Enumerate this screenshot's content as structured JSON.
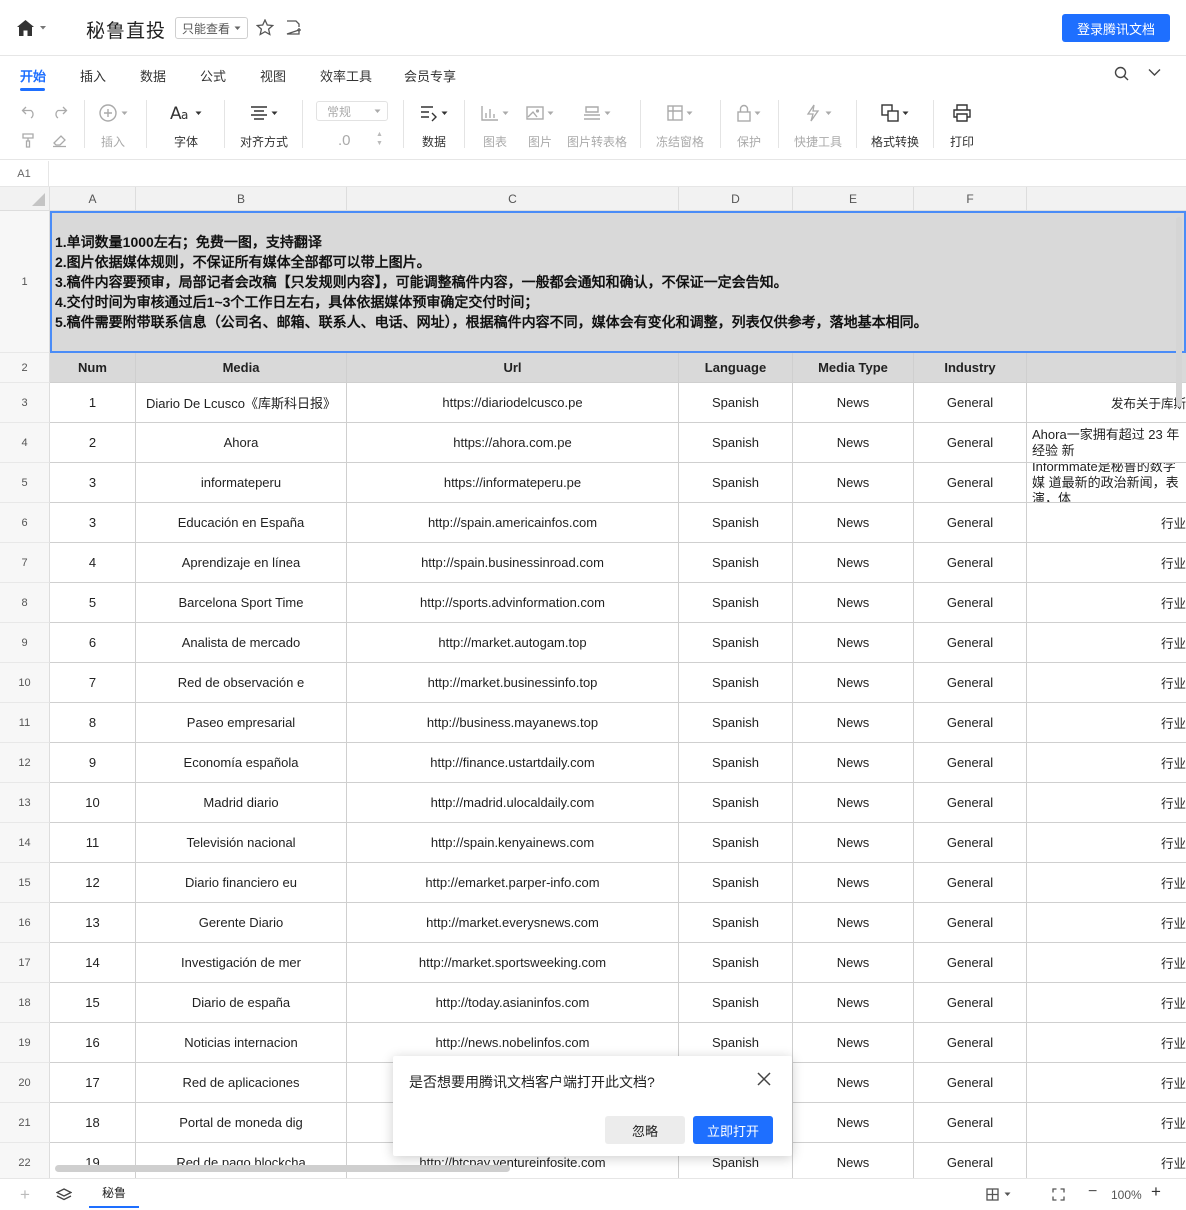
{
  "header": {
    "doc_title": "秘鲁直投",
    "readonly_label": "只能查看",
    "login_button": "登录腾讯文档"
  },
  "menu": {
    "tabs": [
      "开始",
      "插入",
      "数据",
      "公式",
      "视图",
      "效率工具",
      "会员专享"
    ],
    "active_tab": "开始"
  },
  "toolbar": {
    "insert": "插入",
    "font": "字体",
    "align": "对齐方式",
    "number_format": "常规",
    "decimal": ".0",
    "data": "数据",
    "chart": "图表",
    "image": "图片",
    "image_to_table": "图片转表格",
    "freeze": "冻结窗格",
    "protect": "保护",
    "quick_tools": "快捷工具",
    "format_convert": "格式转换",
    "print": "打印"
  },
  "formula_bar": {
    "cell_ref": "A1"
  },
  "sheet": {
    "columns": [
      "A",
      "B",
      "C",
      "D",
      "E",
      "F"
    ],
    "notice_lines": [
      "1.单词数量1000左右；免费一图，支持翻译",
      "2.图片依据媒体规则，不保证所有媒体全部都可以带上图片。",
      "3.稿件内容要预审，局部记者会改稿【只发规则内容】，可能调整稿件内容，一般都会通知和确认，不保证一定会告知。",
      "4.交付时间为审核通过后1~3个工作日左右，具体依据媒体预审确定交付时间；",
      "5.稿件需要附带联系信息（公司名、邮箱、联系人、电话、网址），根据稿件内容不同，媒体会有变化和调整，列表仅供参考，落地基本相同。"
    ],
    "header_row": [
      "Num",
      "Media",
      "Url",
      "Language",
      "Media Type",
      "Industry",
      ""
    ],
    "rows": [
      {
        "rn": "3",
        "num": "1",
        "media": "Diario De Lcusco《库斯科日报》",
        "url": "https://diariodelcusco.pe",
        "lang": "Spanish",
        "type": "News",
        "industry": "General",
        "desc": "发布关于库斯"
      },
      {
        "rn": "4",
        "num": "2",
        "media": "Ahora",
        "url": "https://ahora.com.pe",
        "lang": "Spanish",
        "type": "News",
        "industry": "General",
        "desc": "Ahora一家拥有超过 23 年经验 新"
      },
      {
        "rn": "5",
        "num": "3",
        "media": "informateperu",
        "url": "https://informateperu.pe",
        "lang": "Spanish",
        "type": "News",
        "industry": "General",
        "desc": "Informmate是秘鲁的数字媒 道最新的政治新闻，表演，体"
      },
      {
        "rn": "6",
        "num": "3",
        "media": "Educación en España",
        "url": "http://spain.americainfos.com",
        "lang": "Spanish",
        "type": "News",
        "industry": "General",
        "desc": "行业"
      },
      {
        "rn": "7",
        "num": "4",
        "media": "Aprendizaje en línea",
        "url": "http://spain.businessinroad.com",
        "lang": "Spanish",
        "type": "News",
        "industry": "General",
        "desc": "行业"
      },
      {
        "rn": "8",
        "num": "5",
        "media": "Barcelona Sport Time",
        "url": "http://sports.advinformation.com",
        "lang": "Spanish",
        "type": "News",
        "industry": "General",
        "desc": "行业"
      },
      {
        "rn": "9",
        "num": "6",
        "media": "Analista de mercado",
        "url": "http://market.autogam.top",
        "lang": "Spanish",
        "type": "News",
        "industry": "General",
        "desc": "行业"
      },
      {
        "rn": "10",
        "num": "7",
        "media": "Red de observación e",
        "url": "http://market.businessinfo.top",
        "lang": "Spanish",
        "type": "News",
        "industry": "General",
        "desc": "行业"
      },
      {
        "rn": "11",
        "num": "8",
        "media": "Paseo empresarial",
        "url": "http://business.mayanews.top",
        "lang": "Spanish",
        "type": "News",
        "industry": "General",
        "desc": "行业"
      },
      {
        "rn": "12",
        "num": "9",
        "media": "Economía española",
        "url": "http://finance.ustartdaily.com",
        "lang": "Spanish",
        "type": "News",
        "industry": "General",
        "desc": "行业"
      },
      {
        "rn": "13",
        "num": "10",
        "media": "Madrid diario",
        "url": "http://madrid.ulocaldaily.com",
        "lang": "Spanish",
        "type": "News",
        "industry": "General",
        "desc": "行业"
      },
      {
        "rn": "14",
        "num": "11",
        "media": "Televisión nacional",
        "url": "http://spain.kenyainews.com",
        "lang": "Spanish",
        "type": "News",
        "industry": "General",
        "desc": "行业"
      },
      {
        "rn": "15",
        "num": "12",
        "media": "Diario financiero eu",
        "url": "http://emarket.parper-info.com",
        "lang": "Spanish",
        "type": "News",
        "industry": "General",
        "desc": "行业"
      },
      {
        "rn": "16",
        "num": "13",
        "media": "Gerente Diario",
        "url": "http://market.everysnews.com",
        "lang": "Spanish",
        "type": "News",
        "industry": "General",
        "desc": "行业"
      },
      {
        "rn": "17",
        "num": "14",
        "media": "Investigación de mer",
        "url": "http://market.sportsweeking.com",
        "lang": "Spanish",
        "type": "News",
        "industry": "General",
        "desc": "行业"
      },
      {
        "rn": "18",
        "num": "15",
        "media": "Diario de españa",
        "url": "http://today.asianinfos.com",
        "lang": "Spanish",
        "type": "News",
        "industry": "General",
        "desc": "行业"
      },
      {
        "rn": "19",
        "num": "16",
        "media": "Noticias internacion",
        "url": "http://news.nobelinfos.com",
        "lang": "Spanish",
        "type": "News",
        "industry": "General",
        "desc": "行业"
      },
      {
        "rn": "20",
        "num": "17",
        "media": "Red de aplicaciones",
        "url": "",
        "lang": "",
        "type": "News",
        "industry": "General",
        "desc": "行业"
      },
      {
        "rn": "21",
        "num": "18",
        "media": "Portal de moneda dig",
        "url": "",
        "lang": "",
        "type": "News",
        "industry": "General",
        "desc": "行业"
      },
      {
        "rn": "22",
        "num": "19",
        "media": "Red de pago blockcha",
        "url": "http://btcpay.ventureinfosite.com",
        "lang": "Spanish",
        "type": "News",
        "industry": "General",
        "desc": "行业"
      }
    ]
  },
  "dialog": {
    "message": "是否想要用腾讯文档客户端打开此文档?",
    "ignore": "忽略",
    "open": "立即打开"
  },
  "bottom": {
    "sheet_name": "秘鲁",
    "zoom": "100%"
  },
  "colors": {
    "accent": "#1e6fff",
    "header_fill": "#d9d9d9",
    "selection": "#4a8cf7"
  }
}
